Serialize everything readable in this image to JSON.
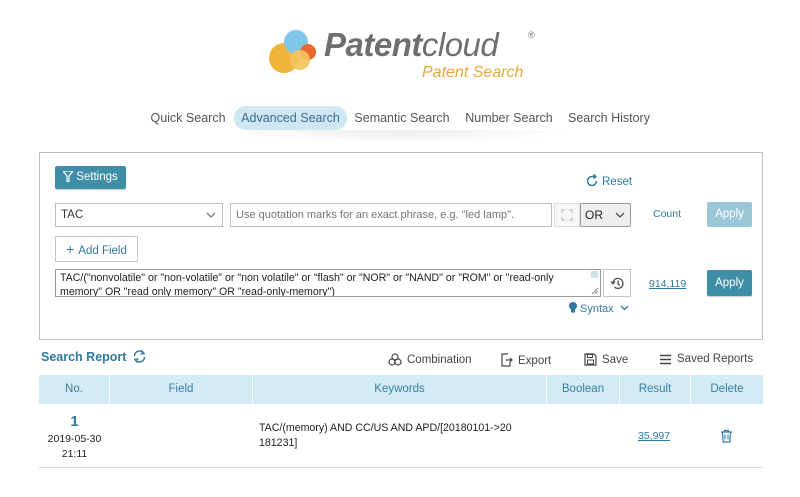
{
  "logo": {
    "title_bold": "Patent",
    "title_light": "cloud",
    "reg": "®",
    "subtitle": "Patent Search"
  },
  "tabs": [
    {
      "label": "Quick Search",
      "active": false
    },
    {
      "label": "Advanced Search",
      "active": true
    },
    {
      "label": "Semantic Search",
      "active": false
    },
    {
      "label": "Number Search",
      "active": false
    },
    {
      "label": "Search History",
      "active": false
    }
  ],
  "panel": {
    "settings_label": "Settings",
    "reset_label": "Reset",
    "field_select": "TAC",
    "keyword_placeholder": "Use quotation marks for an exact phrase, e.g. \"led lamp\".",
    "operator_select": "OR",
    "count_label": "Count",
    "apply_label": "Apply",
    "add_field_label": "Add Field",
    "query_text": "TAC/(\"nonvolatile\" or \"non-volatile\" or \"non volatile\" or \"flash\" or \"NOR\" or \"NAND\" or \"ROM\" or \"read-only memory\" OR \"read only memory\" OR \"read-only-memory\")",
    "result_count": "914,119",
    "apply2_label": "Apply",
    "syntax_label": "Syntax"
  },
  "report": {
    "title": "Search Report",
    "tools": {
      "combination": "Combination",
      "export": "Export",
      "save": "Save",
      "saved_reports": "Saved Reports"
    },
    "columns": [
      "No.",
      "Field",
      "Keywords",
      "Boolean",
      "Result",
      "Delete"
    ],
    "rows": [
      {
        "no": "1",
        "date": "2019-05-30",
        "time": "21:11",
        "field": "",
        "keywords": "TAC/(memory) AND CC/US AND APD/[20180101->20 181231]",
        "boolean": "",
        "result": "35,997"
      }
    ]
  },
  "colors": {
    "accent": "#3f8ea8",
    "link": "#2e7aa3",
    "table_header": "#d3ebf4",
    "logo_orange": "#e9a63a"
  }
}
